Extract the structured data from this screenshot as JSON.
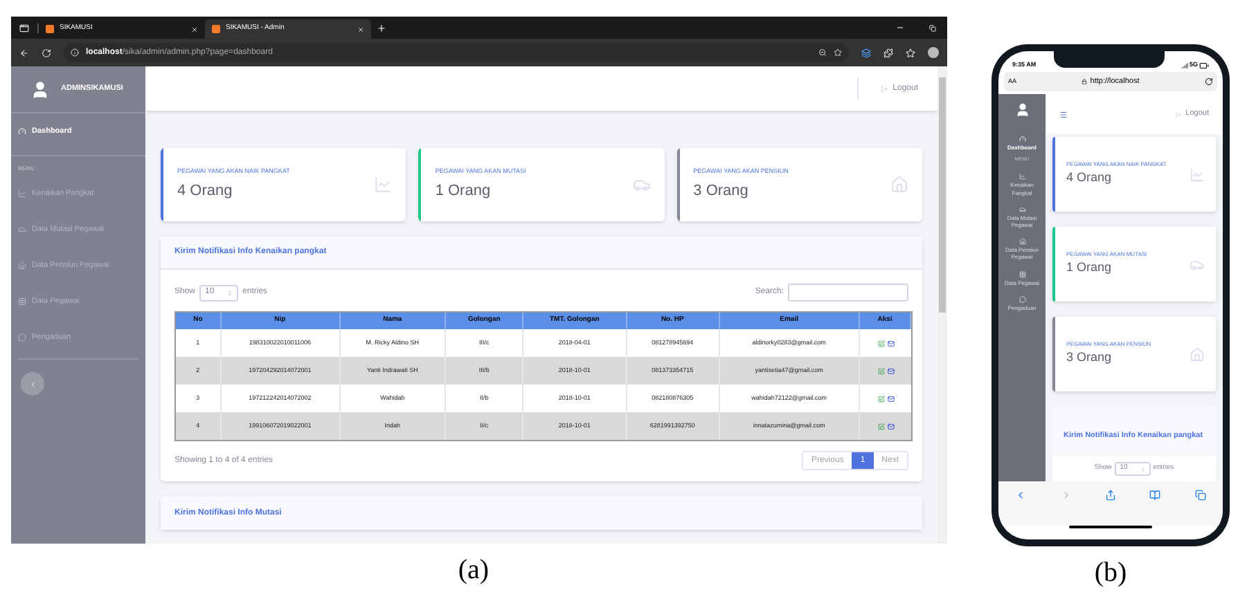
{
  "desktop": {
    "browser": {
      "tabs": [
        {
          "title": "SIKAMUSI",
          "selected": false
        },
        {
          "title": "SIKAMUSI - Admin",
          "selected": true
        }
      ],
      "url_host": "localhost",
      "url_path": "/sika/admin/admin.php?page=dashboard"
    },
    "sidebar": {
      "brand": "ADMINSIKAMUSI",
      "items": [
        {
          "kind": "item",
          "label": "Dashboard",
          "selected": true
        },
        {
          "kind": "heading",
          "label": "MENU"
        },
        {
          "kind": "item",
          "label": "Kenaikan Pangkat",
          "selected": false
        },
        {
          "kind": "item",
          "label": "Data Mutasi Pegawai",
          "selected": false
        },
        {
          "kind": "item",
          "label": "Data Pensiun Pegawai",
          "selected": false
        },
        {
          "kind": "item",
          "label": "Data Pegawai",
          "selected": false
        },
        {
          "kind": "item",
          "label": "Pengaduan",
          "selected": false
        }
      ]
    },
    "topbar": {
      "logout": "Logout"
    },
    "cards": [
      {
        "label": "PEGAWAI YANG AKAN NAIK PANGKAT",
        "value": "4 Orang",
        "color": "#4e73df"
      },
      {
        "label": "PEGAWAI YANG AKAN MUTASI",
        "value": "1 Orang",
        "color": "#1cc88a"
      },
      {
        "label": "PEGAWAI YANG AKAN PENSIUN",
        "value": "3 Orang",
        "color": "#858796"
      }
    ],
    "table_card": {
      "title": "Kirim Notifikasi Info Kenaikan pangkat",
      "show_label": "Show",
      "entries_value": "10",
      "entries_label": "entries",
      "search_label": "Search:",
      "columns": [
        "No",
        "Nip",
        "Nama",
        "Golongan",
        "TMT. Golongan",
        "No. HP",
        "Email",
        "Aksi"
      ],
      "rows": [
        [
          "1",
          "198310022010011006",
          "M. Ricky Aldino SH",
          "III/c",
          "2018-04-01",
          "081278945694",
          "aldinorky0283@gmail.com"
        ],
        [
          "2",
          "197204292014072001",
          "Yanti Indrawati SH",
          "III/b",
          "2018-10-01",
          "081373354715",
          "yantisetia47@gmail.com"
        ],
        [
          "3",
          "197212242014072002",
          "Wahidah",
          "II/b",
          "2018-10-01",
          "082180876305",
          "wahidah72122@gmail.com"
        ],
        [
          "4",
          "199106072019022001",
          "Indah",
          "II/c",
          "2018-10-01",
          "6281991392750",
          "innatazumina@gmail.com"
        ]
      ],
      "info": "Showing 1 to 4 of 4 entries",
      "pagination": [
        {
          "label": "Previous",
          "selected": false
        },
        {
          "label": "1",
          "selected": true
        },
        {
          "label": "Next",
          "selected": false
        }
      ]
    },
    "next_card_title": "Kirim Notifikasi Info Mutasi",
    "caption": "(a)"
  },
  "mobile": {
    "status_time": "9:35 AM",
    "network": "5G",
    "text_size": "AA",
    "url": "http://localhost",
    "sidebar": {
      "items": [
        {
          "kind": "item",
          "label": "Dashboard",
          "selected": true
        },
        {
          "kind": "heading",
          "label": "MENU"
        },
        {
          "kind": "item",
          "label": "Kenaikan Pangkat",
          "selected": false
        },
        {
          "kind": "item",
          "label": "Data Mutasi Pegawai",
          "selected": false
        },
        {
          "kind": "item",
          "label": "Data Pensiun Pegawai",
          "selected": false
        },
        {
          "kind": "item",
          "label": "Data Pegawai",
          "selected": false
        },
        {
          "kind": "item",
          "label": "Pengaduan",
          "selected": false
        }
      ]
    },
    "topbar": {
      "logout": "Logout"
    },
    "cards": [
      {
        "label": "PEGAWAI YANG AKAN NAIK PANGKAT",
        "value": "4 Orang",
        "color": "#4e73df"
      },
      {
        "label": "PEGAWAI YANG AKAN MUTASI",
        "value": "1 Orang",
        "color": "#1cc88a"
      },
      {
        "label": "PEGAWAI YANG AKAN PENSIUN",
        "value": "3 Orang",
        "color": "#858796"
      }
    ],
    "table_card": {
      "title": "Kirim Notifikasi Info Kenaikan pangkat",
      "show_label": "Show",
      "entries_value": "10",
      "entries_label": "entries"
    },
    "caption": "(b)"
  }
}
